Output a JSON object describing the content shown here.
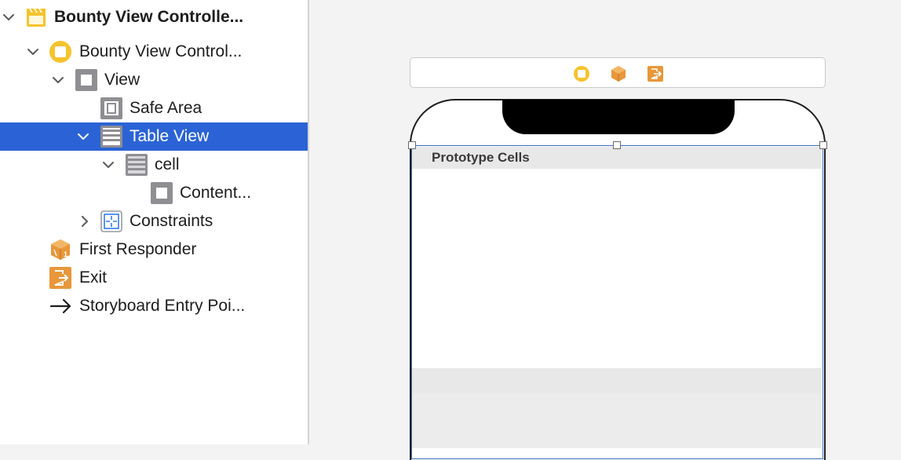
{
  "outline": {
    "scene_title": "Bounty View Controlle...",
    "items": [
      {
        "label": "Bounty View Control..."
      },
      {
        "label": "View"
      },
      {
        "label": "Safe Area"
      },
      {
        "label": "Table View"
      },
      {
        "label": "cell"
      },
      {
        "label": "Content..."
      },
      {
        "label": "Constraints"
      },
      {
        "label": "First Responder"
      },
      {
        "label": "Exit"
      },
      {
        "label": "Storyboard Entry Poi..."
      }
    ],
    "selected_item": "Table View"
  },
  "canvas": {
    "prototype_header": "Prototype Cells",
    "scene_dock_icons": [
      "view-controller-icon",
      "first-responder-icon",
      "exit-icon"
    ]
  },
  "colors": {
    "selection": "#2b63d6",
    "controller_yellow": "#f5c32c",
    "responder_orange": "#e8973a",
    "constraint_blue": "#3478f6"
  }
}
